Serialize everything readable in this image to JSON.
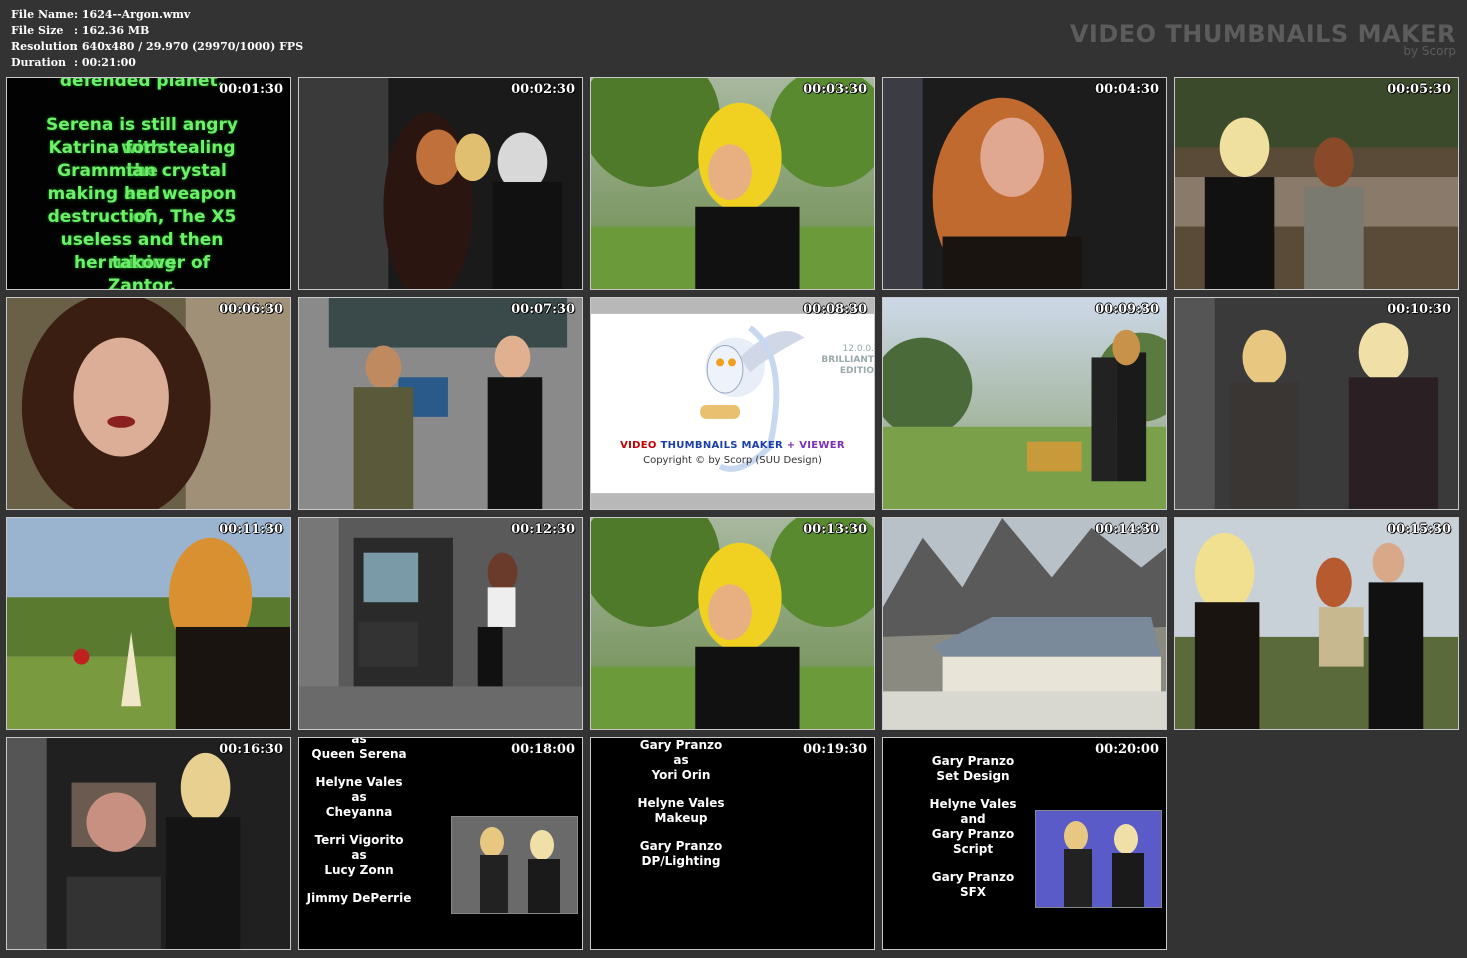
{
  "file_info": [
    {
      "label": "File Name",
      "value": ": 1624--Argon.wmv"
    },
    {
      "label": "File Size",
      "value": ": 162.36 MB"
    },
    {
      "label": "Resolution",
      "value": ": 640x480 / 29.970 (29970/1000) FPS"
    },
    {
      "label": "Duration",
      "value": ": 00:21:00"
    }
  ],
  "brand": {
    "title": "VIDEO THUMBNAILS MAKER",
    "subtitle": "by Scorp"
  },
  "thumbnails": [
    {
      "time": "00:01:30"
    },
    {
      "time": "00:02:30"
    },
    {
      "time": "00:03:30"
    },
    {
      "time": "00:04:30"
    },
    {
      "time": "00:05:30"
    },
    {
      "time": "00:06:30"
    },
    {
      "time": "00:07:30"
    },
    {
      "time": "00:08:30"
    },
    {
      "time": "00:09:30"
    },
    {
      "time": "00:10:30"
    },
    {
      "time": "00:11:30"
    },
    {
      "time": "00:12:30"
    },
    {
      "time": "00:13:30"
    },
    {
      "time": "00:14:30"
    },
    {
      "time": "00:15:30"
    },
    {
      "time": "00:16:30"
    },
    {
      "time": "00:18:00"
    },
    {
      "time": "00:19:30"
    },
    {
      "time": "00:20:00"
    }
  ],
  "frame_text": {
    "intro_top": "defended planet.",
    "intro_lines": [
      "Serena is still angry with",
      "Katrina for stealing the",
      "Grammian crystal and",
      "making her weapon of",
      "destruction, The X5",
      "useless and then ruining",
      "her takover of Zantor."
    ],
    "logo_title_a": "VIDEO ",
    "logo_title_b": "THUMBNAILS MAKER",
    "logo_title_c": " + VIEWER",
    "logo_copy": "Copyright © by Scorp (SUU Design)",
    "logo_version": "12.0.0.",
    "logo_edition_a": "BRILLIANT",
    "logo_edition_b": "EDITIO",
    "credits_17": [
      "as",
      "Queen Serena",
      "",
      "Helyne Vales",
      "as",
      "Cheyanna",
      "",
      "Terri Vigorito",
      "as",
      "Lucy Zonn",
      "",
      "Jimmy DePerrie"
    ],
    "credits_18": [
      "Gary Pranzo",
      "as",
      "Yori Orin",
      "",
      "Helyne Vales",
      "Makeup",
      "",
      "Gary Pranzo",
      "DP/Lighting"
    ],
    "credits_19": [
      "Gary Pranzo",
      "Set Design",
      "",
      "Helyne Vales",
      "and",
      "Gary Pranzo",
      "Script",
      "",
      "Gary Pranzo",
      "SFX"
    ]
  }
}
